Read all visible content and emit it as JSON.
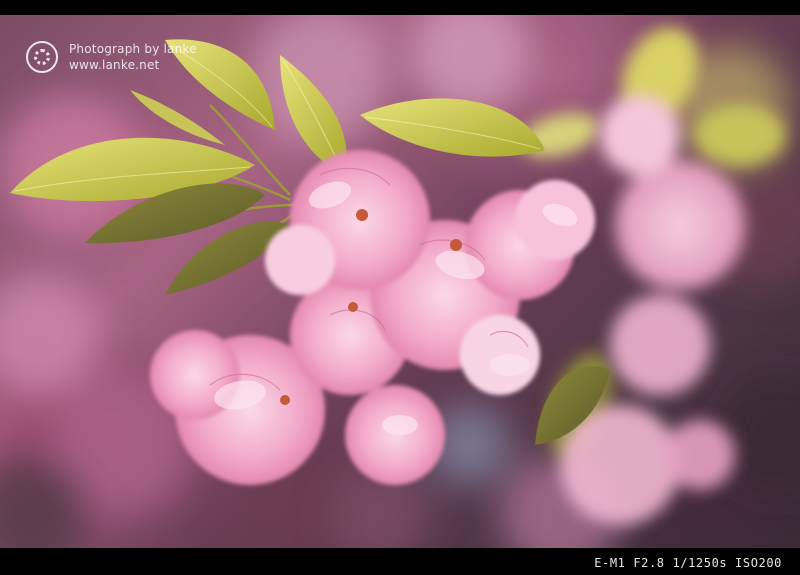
{
  "watermark": {
    "line1": "Photograph by lanke",
    "line2": "www.lanke.net"
  },
  "exif": {
    "text": "E-M1 F2.8 1/1250s ISO200"
  },
  "colors": {
    "frame": "#000000",
    "blossom_pink": "#f2a8c8",
    "leaf_green": "#c9c84a"
  },
  "icons": [
    "aperture-logo-icon"
  ]
}
